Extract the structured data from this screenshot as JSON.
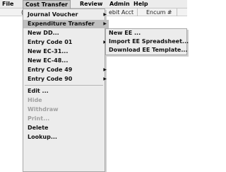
{
  "menubar": {
    "items": [
      "File",
      "Cost Transfer",
      "Review",
      "Admin",
      "Help"
    ]
  },
  "table_header": {
    "col_c": "(",
    "col_debit": "ebit Acct",
    "col_encum": "Encum #"
  },
  "cost_transfer_menu": {
    "items": [
      {
        "label": "Journal Voucher",
        "has_submenu": true
      },
      {
        "label": "Expenditure Transfer",
        "has_submenu": true
      },
      {
        "label": "New DD...",
        "has_submenu": false
      },
      {
        "label": "Entry Code 01",
        "has_submenu": true
      },
      {
        "label": "New EC-31...",
        "has_submenu": false
      },
      {
        "label": "New EC-48...",
        "has_submenu": false
      },
      {
        "label": "Entry Code 49",
        "has_submenu": true
      },
      {
        "label": "Entry Code 90",
        "has_submenu": true
      },
      {
        "label": "Edit ...",
        "has_submenu": false
      },
      {
        "label": "Hide",
        "has_submenu": false,
        "disabled": true
      },
      {
        "label": "Withdraw",
        "has_submenu": false,
        "disabled": true
      },
      {
        "label": "Print...",
        "has_submenu": false,
        "disabled": true
      },
      {
        "label": "Delete",
        "has_submenu": false
      },
      {
        "label": "Lookup...",
        "has_submenu": false
      }
    ],
    "highlighted": "Expenditure Transfer"
  },
  "expenditure_transfer_submenu": {
    "items": [
      "New EE ...",
      "Import EE Spreadsheet...",
      "Download EE Template..."
    ]
  },
  "icons": {
    "submenu_arrow": "triangle-right-icon"
  },
  "colors": {
    "menu_bg": "#ececec",
    "highlight_bg": "#bfbfbf",
    "disabled_text": "#a0a0a0"
  }
}
